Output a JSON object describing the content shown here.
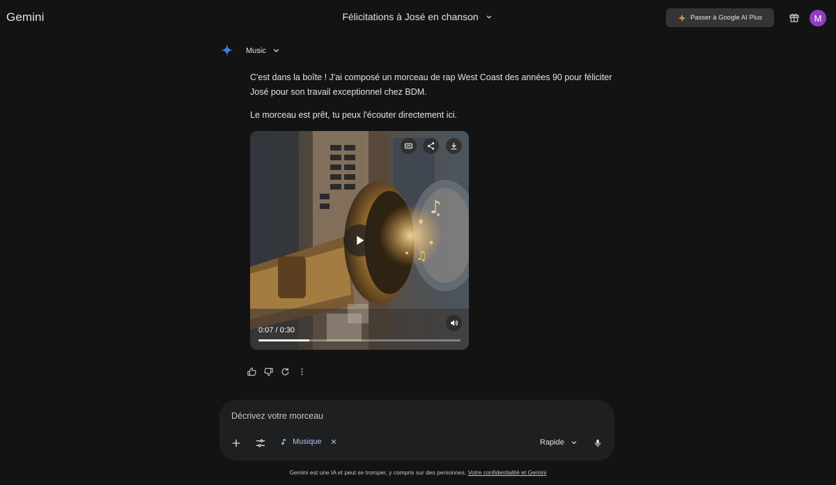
{
  "app": {
    "brand": "Gemini"
  },
  "header": {
    "conversation_title": "Félicitations à José en chanson",
    "upgrade_label": "Passer à Google AI Plus",
    "avatar_initial": "M"
  },
  "response": {
    "model_label": "Music",
    "paragraph1": "C'est dans la boîte ! J'ai composé un morceau de rap West Coast des années 90 pour féliciter José pour son travail exceptionnel chez BDM.",
    "paragraph2": "Le morceau est prêt, tu peux l'écouter directement ici.",
    "player": {
      "time": "0:07 / 0:30",
      "progress": 0.25,
      "icons": [
        "captions-icon",
        "share-icon",
        "download-icon",
        "play-icon",
        "volume-icon"
      ]
    },
    "actions": [
      "thumbs-up-icon",
      "thumbs-down-icon",
      "regenerate-icon",
      "more-vert-icon"
    ]
  },
  "composer": {
    "placeholder": "Décrivez votre morceau",
    "chip_label": "Musique",
    "mode_label": "Rapide"
  },
  "footer": {
    "text": "Gemini est une IA et peut se tromper, y compris sur des personnes.",
    "link": "Votre confidentialité et Gemini"
  },
  "colors": {
    "background": "#131314",
    "surface": "#1e1f20",
    "accent": "#a8c7fa",
    "avatar": "#8e3fc2"
  }
}
